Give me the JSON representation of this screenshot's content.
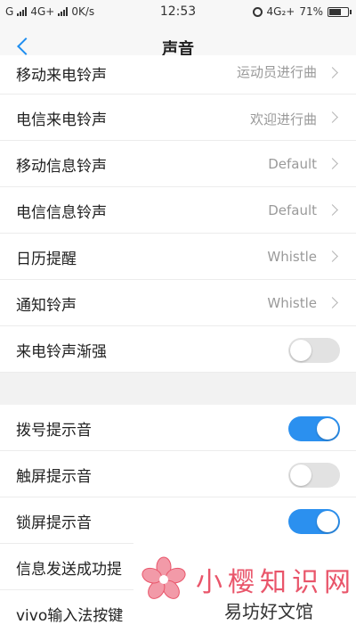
{
  "status_bar": {
    "carrier_left": "G",
    "network": "4G+",
    "speed": "0K/s",
    "time": "12:53",
    "network_right": "4G₂+",
    "battery_text": "71%",
    "battery_level": 0.71
  },
  "nav": {
    "title": "声音"
  },
  "rows": [
    {
      "label": "移动来电铃声",
      "value": "运动员进行曲"
    },
    {
      "label": "电信来电铃声",
      "value": "欢迎进行曲"
    },
    {
      "label": "移动信息铃声",
      "value": "Default"
    },
    {
      "label": "电信信息铃声",
      "value": "Default"
    },
    {
      "label": "日历提醒",
      "value": "Whistle"
    },
    {
      "label": "通知铃声",
      "value": "Whistle"
    },
    {
      "label": "来电铃声渐强",
      "toggle": false
    }
  ],
  "rows2": [
    {
      "label": "拨号提示音",
      "toggle": true
    },
    {
      "label": "触屏提示音",
      "toggle": false
    },
    {
      "label": "锁屏提示音",
      "toggle": true
    },
    {
      "label": "信息发送成功提"
    },
    {
      "label": "vivo输入法按键"
    }
  ],
  "watermark": {
    "brand": "小樱知识网",
    "site": "易坊好文馆"
  },
  "colors": {
    "accent": "#2b90ef",
    "toggle_off": "#e2e2e2",
    "watermark": "#e9556a"
  }
}
